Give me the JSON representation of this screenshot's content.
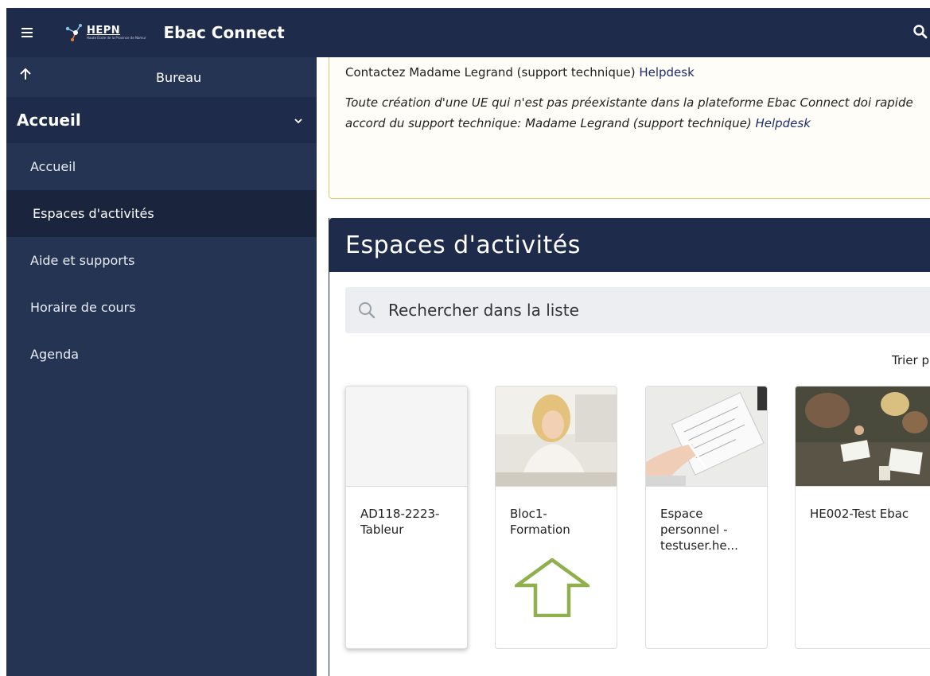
{
  "header": {
    "logo_text": "HEPN",
    "logo_subtext": "Haute École de la Province de Namur",
    "app_title": "Ebac Connect",
    "icons": [
      "hamburger-icon",
      "search-icon"
    ]
  },
  "sidebar": {
    "back_label": "Bureau",
    "section_label": "Accueil",
    "items": [
      {
        "label": "Accueil",
        "active": false
      },
      {
        "label": "Espaces d'activités",
        "active": true
      },
      {
        "label": "Aide et supports",
        "active": false
      },
      {
        "label": "Horaire de cours",
        "active": false
      },
      {
        "label": "Agenda",
        "active": false
      }
    ]
  },
  "notice": {
    "line1_text": "Contactez Madame Legrand (support technique) ",
    "line1_link": "Helpdesk",
    "line2_text": "Toute création d'une UE qui n'est pas préexistante dans la plateforme Ebac Connect doi rapide accord du support technique: Madame Legrand (support technique) ",
    "line2_link": "Helpdesk"
  },
  "panel": {
    "title": "Espaces d'activités",
    "search_placeholder": "Rechercher dans la liste",
    "sort_label": "Trier p"
  },
  "cards": [
    {
      "title": "AD118-2223-Tableur"
    },
    {
      "title": "Bloc1-Formation"
    },
    {
      "title": "Espace personnel - testuser.he..."
    },
    {
      "title": "HE002-Test Ebac"
    }
  ],
  "colors": {
    "navbar": "#1f2b4a",
    "sidebar": "#263453",
    "active_item": "#1b243d",
    "notice_border": "#e6c472",
    "annotation_arrow": "#8fb04c"
  }
}
